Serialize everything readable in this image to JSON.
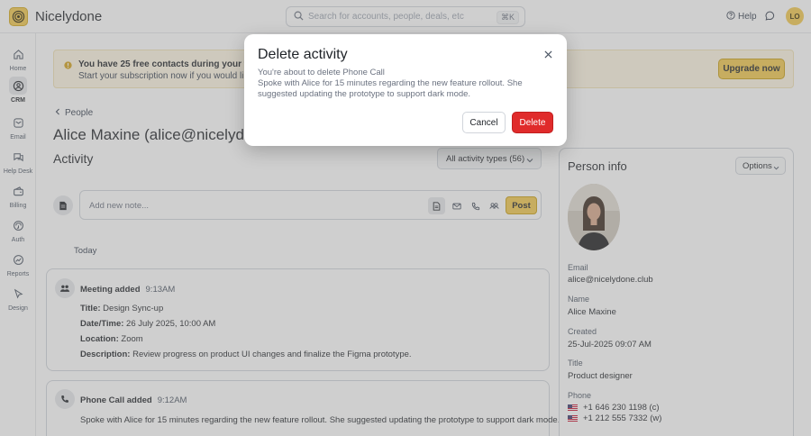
{
  "app": {
    "name": "Nicelydone",
    "user_initials": "LO"
  },
  "search": {
    "placeholder": "Search for accounts, people, deals, etc",
    "shortcut": "⌘K"
  },
  "header": {
    "help_label": "Help"
  },
  "nav": {
    "items": [
      {
        "label": "Home",
        "icon": "home-icon"
      },
      {
        "label": "CRM",
        "icon": "crm-icon"
      },
      {
        "label": "Email",
        "icon": "email-icon"
      },
      {
        "label": "Help Desk",
        "icon": "help-desk-icon"
      },
      {
        "label": "Billing",
        "icon": "billing-icon"
      },
      {
        "label": "Auth",
        "icon": "auth-icon"
      },
      {
        "label": "Reports",
        "icon": "reports-icon"
      },
      {
        "label": "Design",
        "icon": "design-icon"
      }
    ],
    "active": "CRM"
  },
  "banner": {
    "line1": "You have 25 free contacts during your free trial",
    "line2": "Start your subscription now if you would like to i",
    "cta": "Upgrade now"
  },
  "breadcrumb": {
    "label": "People"
  },
  "person": {
    "title": "Alice Maxine (alice@nicelydone.c"
  },
  "activity": {
    "heading": "Activity",
    "filter_label": "All activity types (56)",
    "note_placeholder": "Add new note...",
    "post_label": "Post",
    "group_label": "Today",
    "entries": [
      {
        "title": "Meeting added",
        "time": "9:13AM",
        "fields": [
          {
            "label": "Title:",
            "value": "Design Sync-up"
          },
          {
            "label": "Date/Time:",
            "value": "26 July 2025, 10:00 AM"
          },
          {
            "label": "Location:",
            "value": "Zoom"
          },
          {
            "label": "Description:",
            "value": "Review progress on product UI changes and finalize the Figma prototype."
          }
        ]
      },
      {
        "title": "Phone Call added",
        "time": "9:12AM",
        "body": "Spoke with Alice for 15 minutes regarding the new feature rollout. She suggested updating the prototype to support dark mode."
      }
    ]
  },
  "person_info": {
    "heading": "Person info",
    "options_label": "Options",
    "email_label": "Email",
    "email": "alice@nicelydone.club",
    "name_label": "Name",
    "name": "Alice Maxine",
    "created_label": "Created",
    "created": "25-Jul-2025 09:07 AM",
    "title_label": "Title",
    "title": "Product designer",
    "phone_label": "Phone",
    "phones": [
      "+1 646 230 1198 (c)",
      "+1 212 555 7332 (w)"
    ]
  },
  "modal": {
    "title": "Delete activity",
    "line1": "You're about to delete Phone Call",
    "line2": "Spoke with Alice for 15 minutes regarding the new feature rollout. She suggested updating the prototype to support dark mode.",
    "cancel_label": "Cancel",
    "delete_label": "Delete",
    "delete_color": "#e02b2b"
  },
  "colors": {
    "accent": "#f2c94c",
    "danger": "#e02b2b"
  }
}
